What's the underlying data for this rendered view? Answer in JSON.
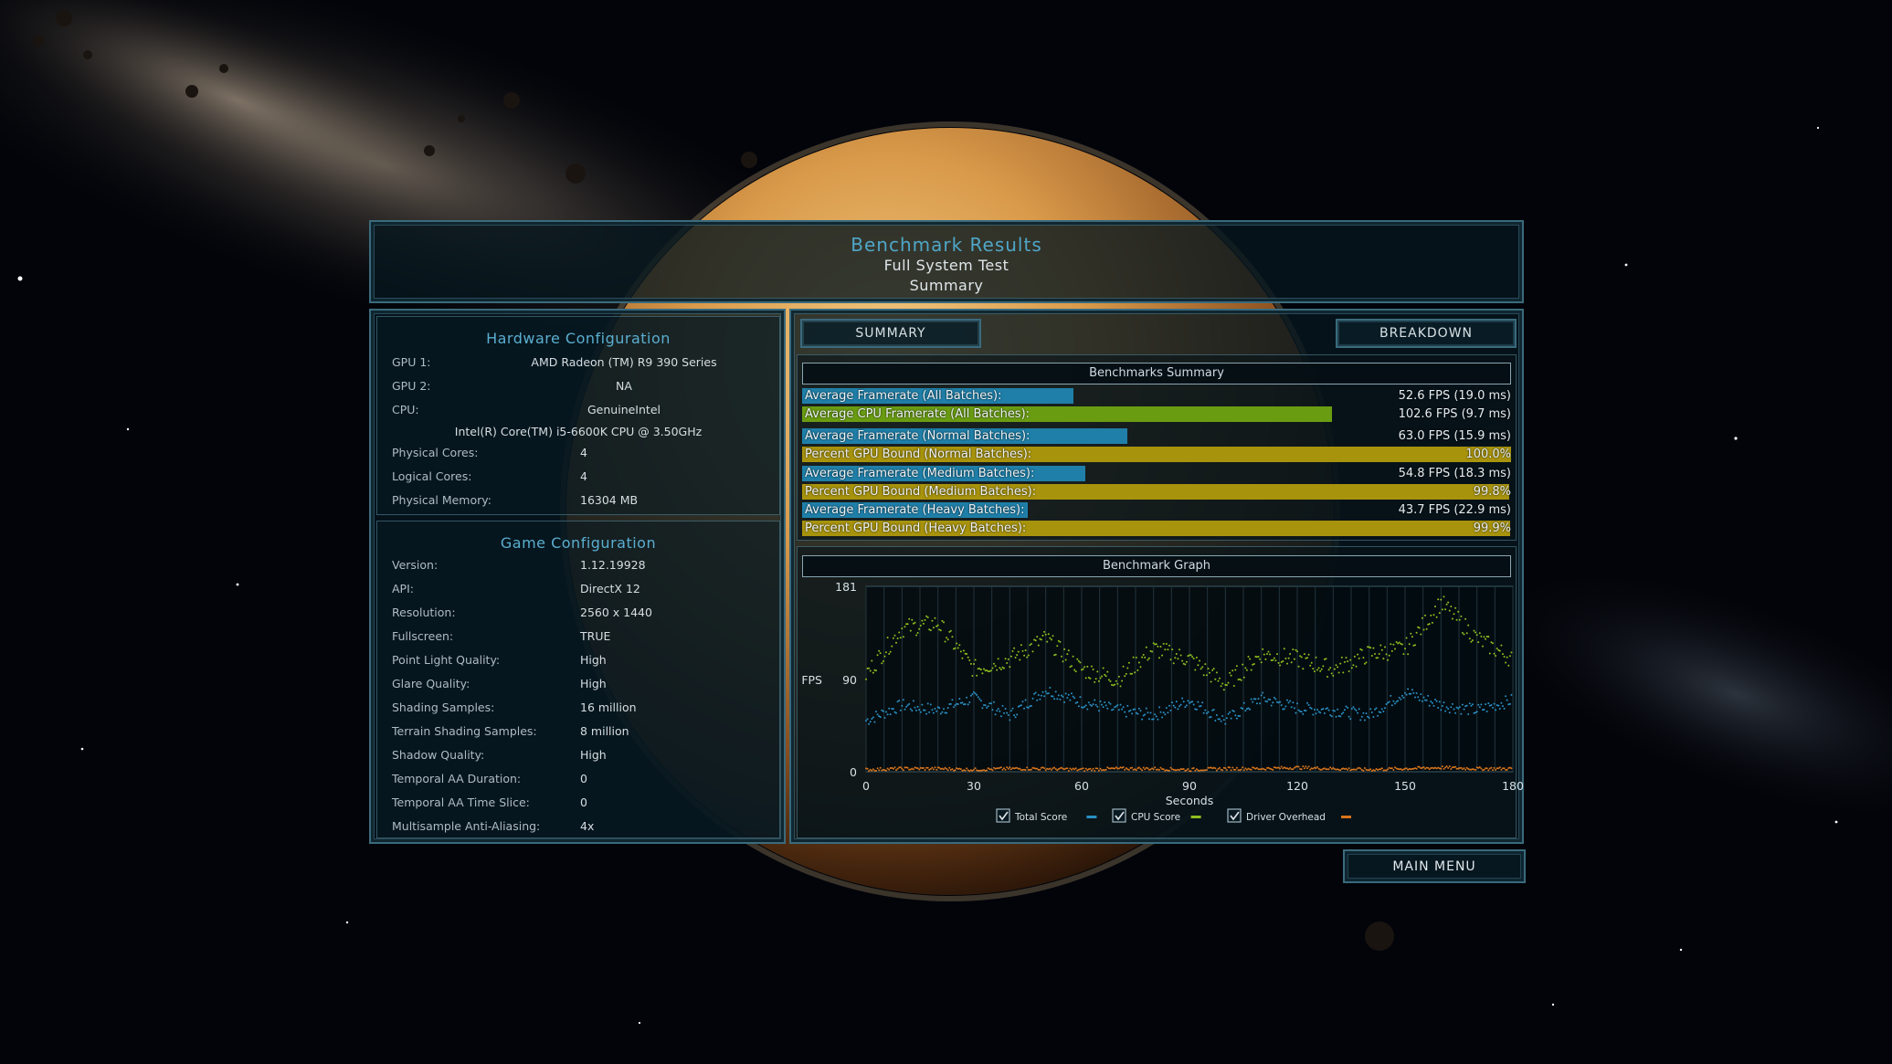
{
  "header": {
    "title": "Benchmark Results",
    "subtitle": "Full System Test",
    "page": "Summary"
  },
  "hardware": {
    "title": "Hardware Configuration",
    "gpu1": {
      "label": "GPU 1:",
      "value": "AMD Radeon (TM) R9 390 Series"
    },
    "gpu2": {
      "label": "GPU 2:",
      "value": "NA"
    },
    "cpu": {
      "label": "CPU:",
      "value": "GenuineIntel"
    },
    "cpu_model": "Intel(R) Core(TM) i5-6600K CPU @ 3.50GHz",
    "physical_cores": {
      "label": "Physical Cores:",
      "value": "4"
    },
    "logical_cores": {
      "label": "Logical Cores:",
      "value": "4"
    },
    "physical_memory": {
      "label": "Physical Memory:",
      "value": "16304  MB"
    }
  },
  "game": {
    "title": "Game Configuration",
    "rows": [
      {
        "label": "Version:",
        "value": "1.12.19928"
      },
      {
        "label": "API:",
        "value": "DirectX 12"
      },
      {
        "label": "Resolution:",
        "value": "2560 x 1440"
      },
      {
        "label": "Fullscreen:",
        "value": "TRUE"
      },
      {
        "label": "Point Light Quality:",
        "value": "High"
      },
      {
        "label": "Glare Quality:",
        "value": "High"
      },
      {
        "label": "Shading Samples:",
        "value": "16 million"
      },
      {
        "label": "Terrain Shading Samples:",
        "value": "8 million"
      },
      {
        "label": "Shadow Quality:",
        "value": "High"
      },
      {
        "label": "Temporal AA Duration:",
        "value": "0"
      },
      {
        "label": "Temporal AA Time Slice:",
        "value": "0"
      },
      {
        "label": "Multisample Anti-Aliasing:",
        "value": "4x"
      }
    ]
  },
  "tabs": {
    "summary": "SUMMARY",
    "breakdown": "BREAKDOWN"
  },
  "summary_box": {
    "title": "Benchmarks Summary",
    "metrics": [
      {
        "label": "Average Framerate (All Batches):",
        "value": "52.6 FPS (19.0 ms)",
        "fraction": 0.383,
        "color": "#1f7fa8"
      },
      {
        "label": "Average CPU Framerate (All Batches):",
        "value": "102.6 FPS (9.7 ms)",
        "fraction": 0.747,
        "color": "#6a9c12"
      },
      {
        "label": "Average Framerate (Normal Batches):",
        "value": "63.0 FPS (15.9 ms)",
        "fraction": 0.459,
        "color": "#1f7fa8"
      },
      {
        "label": "Percent GPU Bound (Normal Batches):",
        "value": "100.0%",
        "fraction": 1.0,
        "color": "#a8930c"
      },
      {
        "label": "Average Framerate (Medium Batches):",
        "value": "54.8 FPS (18.3 ms)",
        "fraction": 0.399,
        "color": "#1f7fa8"
      },
      {
        "label": "Percent GPU Bound (Medium Batches):",
        "value": "99.8%",
        "fraction": 0.998,
        "color": "#a8930c"
      },
      {
        "label": "Average Framerate (Heavy Batches):",
        "value": "43.7 FPS (22.9 ms)",
        "fraction": 0.318,
        "color": "#1f7fa8"
      },
      {
        "label": "Percent GPU Bound (Heavy Batches):",
        "value": "99.9%",
        "fraction": 0.999,
        "color": "#a8930c"
      }
    ]
  },
  "graph_box": {
    "title": "Benchmark Graph"
  },
  "chart_data": {
    "type": "scatter",
    "title": "Benchmark Graph",
    "xlabel": "Seconds",
    "ylabel": "FPS",
    "xlim": [
      0,
      180
    ],
    "ylim": [
      0,
      181
    ],
    "x_ticks": [
      "0",
      "30",
      "60",
      "90",
      "120",
      "150",
      "180"
    ],
    "y_ticks": [
      "0",
      "90",
      "181"
    ],
    "legend_position": "bottom-center",
    "series": [
      {
        "name": "Total Score",
        "color": "#2a8fc4",
        "x": [
          0,
          10,
          20,
          30,
          40,
          50,
          60,
          70,
          80,
          90,
          100,
          110,
          120,
          130,
          140,
          150,
          160,
          170,
          180
        ],
        "y": [
          50,
          65,
          60,
          72,
          55,
          80,
          68,
          60,
          55,
          70,
          50,
          72,
          62,
          60,
          55,
          78,
          65,
          60,
          70
        ]
      },
      {
        "name": "CPU Score",
        "color": "#8fbf1e",
        "x": [
          0,
          10,
          20,
          30,
          40,
          50,
          60,
          70,
          80,
          90,
          100,
          110,
          120,
          130,
          140,
          150,
          160,
          170,
          180
        ],
        "y": [
          95,
          140,
          145,
          100,
          110,
          130,
          100,
          90,
          120,
          110,
          85,
          115,
          110,
          100,
          115,
          120,
          165,
          130,
          110
        ]
      },
      {
        "name": "Driver Overhead",
        "color": "#d8741c",
        "x": [
          0,
          10,
          20,
          30,
          40,
          50,
          60,
          70,
          80,
          90,
          100,
          110,
          120,
          130,
          140,
          150,
          160,
          170,
          180
        ],
        "y": [
          2,
          3,
          3,
          2,
          3,
          3,
          2,
          3,
          3,
          2,
          3,
          3,
          4,
          3,
          2,
          3,
          4,
          3,
          3
        ]
      }
    ]
  },
  "main_menu": "MAIN MENU"
}
